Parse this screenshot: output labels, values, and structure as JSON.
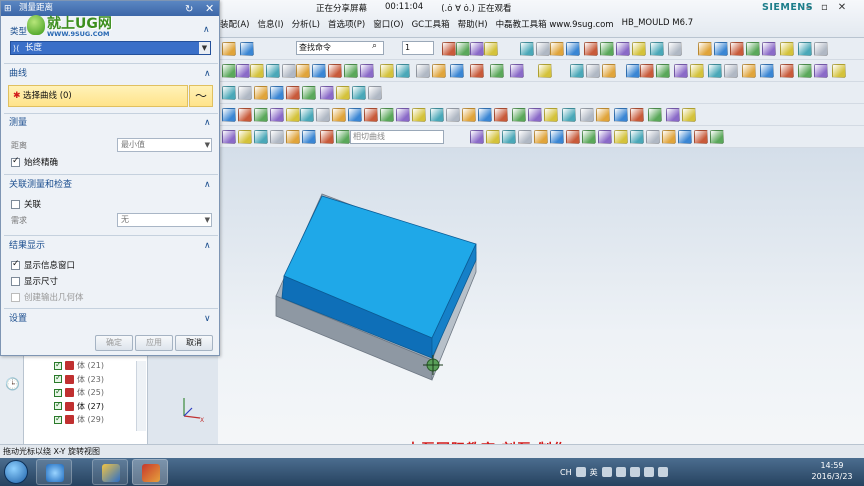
{
  "share_bar": {
    "status": "正在分享屏幕",
    "timer": "00:11:04",
    "viewer": "(.ȯ ∀ ȯ.) 正在观看"
  },
  "brand": "SIEMENS",
  "menu": [
    "装配(A)",
    "信息(I)",
    "分析(L)",
    "首选项(P)",
    "窗口(O)",
    "GC工具箱",
    "帮助(H)",
    "中磊教工具箱 www.9sug.com",
    "HB_MOULD M6.7"
  ],
  "toolbar": {
    "find_command_placeholder": "查找命令",
    "layer_value": "1",
    "snap_curve_placeholder": "相切曲线"
  },
  "dialog": {
    "title": "测量距离",
    "logo_text": "就上UG网",
    "logo_url": "WWW.9SUG.COM",
    "type_label": "类型",
    "type_value": "长度",
    "sections": {
      "curve": "曲线",
      "measure": "测量",
      "assoc": "关联测量和检查",
      "results": "结果显示",
      "settings": "设置"
    },
    "select_curve": "选择曲线 (0)",
    "distance_label": "距离",
    "distance_value": "最小值",
    "always_precise": "始终精确",
    "associative": "关联",
    "requirement_label": "需求",
    "requirement_value": "无",
    "show_info_window": "显示信息窗口",
    "show_dimension": "显示尺寸",
    "create_output_geometry": "创建输出几何体",
    "buttons": {
      "ok": "确定",
      "apply": "应用",
      "cancel": "取消"
    }
  },
  "tree": [
    {
      "label": "体 (21)",
      "active": false
    },
    {
      "label": "体 (23)",
      "active": false
    },
    {
      "label": "体 (25)",
      "active": false
    },
    {
      "label": "体 (27)",
      "active": true
    },
    {
      "label": "体 (29)",
      "active": false
    }
  ],
  "credit": "中磊国际教育  刘磊  制作",
  "status_bar": "拖动光标以绕 X-Y 旋转视图",
  "taskbar": {
    "ime": "CH",
    "ime_mode": "英",
    "time": "14:59",
    "date": "2016/3/23"
  },
  "colors": {
    "block_top": "#1fa8e8",
    "block_side": "#0e6fb8",
    "block_base": "#9ea8b3",
    "dialog_title": "#3c67a8",
    "credit": "#d11a1a"
  }
}
